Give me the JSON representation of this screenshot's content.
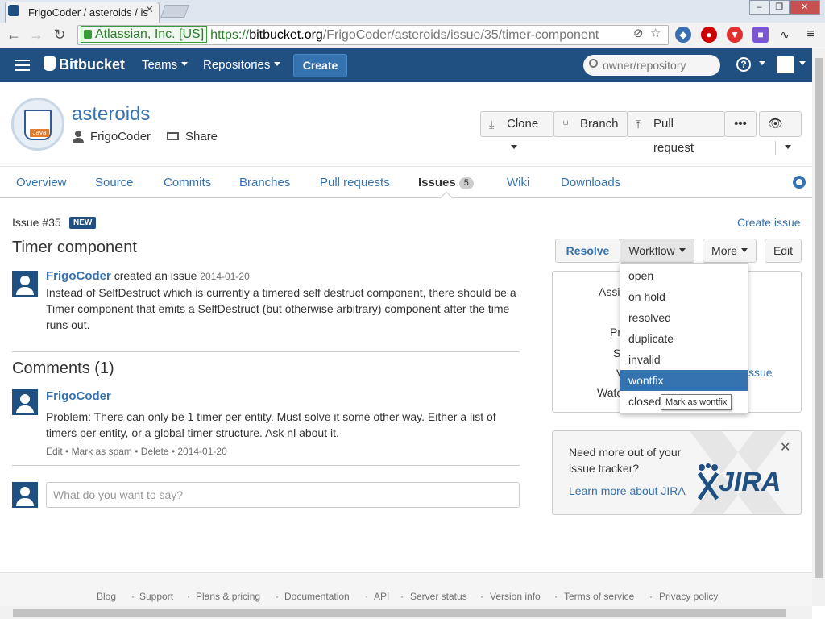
{
  "browser": {
    "tab_title": "FrigoCoder / asteroids / is",
    "ev_label": "Atlassian, Inc. [US]",
    "url_scheme": "https://",
    "url_host": "bitbucket.org",
    "url_path": "/FrigoCoder/asteroids/issue/35/timer-component"
  },
  "header": {
    "logo": "Bitbucket",
    "teams": "Teams",
    "repositories": "Repositories",
    "create": "Create",
    "search_placeholder": "owner/repository",
    "help": "?"
  },
  "repo": {
    "name": "asteroids",
    "owner": "FrigoCoder",
    "share": "Share",
    "avatar_label": "Java",
    "actions": {
      "clone": "Clone",
      "branch": "Branch",
      "pull_request": "Pull request",
      "more": "•••"
    }
  },
  "nav": {
    "tabs": [
      {
        "label": "Overview"
      },
      {
        "label": "Source"
      },
      {
        "label": "Commits"
      },
      {
        "label": "Branches"
      },
      {
        "label": "Pull requests"
      },
      {
        "label": "Issues",
        "badge": "5"
      },
      {
        "label": "Wiki"
      },
      {
        "label": "Downloads"
      }
    ]
  },
  "issue": {
    "id": "Issue #35",
    "status_badge": "NEW",
    "create_issue": "Create issue",
    "title": "Timer component",
    "actions": {
      "resolve": "Resolve",
      "workflow": "Workflow",
      "more": "More",
      "edit": "Edit"
    },
    "author": "FrigoCoder",
    "created_text": "created an issue",
    "created_date": "2014-01-20",
    "description": "Instead of SelfDestruct which is currently a timered self destruct component, there should be a Timer component that emits a SelfDestruct (but otherwise arbitrary) component after the time runs out."
  },
  "comments": {
    "title": "Comments (1)",
    "items": [
      {
        "author": "FrigoCoder",
        "text": "Problem: There can only be 1 timer per entity. Must solve it some other way. Either a list of timers per entity, or a global timer structure. Ask nl about it.",
        "edit": "Edit",
        "spam": "Mark as spam",
        "delete": "Delete",
        "date": "2014-01-20"
      }
    ],
    "input_placeholder": "What do you want to say?"
  },
  "sidebar": {
    "labels": [
      "Assi",
      "Pr",
      "S",
      "V",
      "Watc"
    ],
    "issue_link_fragment": "ssue",
    "jira": {
      "text": "Need more out of your issue tracker?",
      "link": "Learn more about JIRA",
      "logo": "JIRA"
    }
  },
  "workflow_menu": {
    "items": [
      "open",
      "on hold",
      "resolved",
      "duplicate",
      "invalid",
      "wontfix",
      "closed"
    ],
    "selected": "wontfix",
    "tooltip": "Mark as wontfix"
  },
  "footer": {
    "links": [
      "Blog",
      "Support",
      "Plans & pricing",
      "Documentation",
      "API",
      "Server status",
      "Version info",
      "Terms of service",
      "Privacy policy"
    ]
  },
  "colors": {
    "brand": "#205081",
    "link": "#3572b0"
  }
}
